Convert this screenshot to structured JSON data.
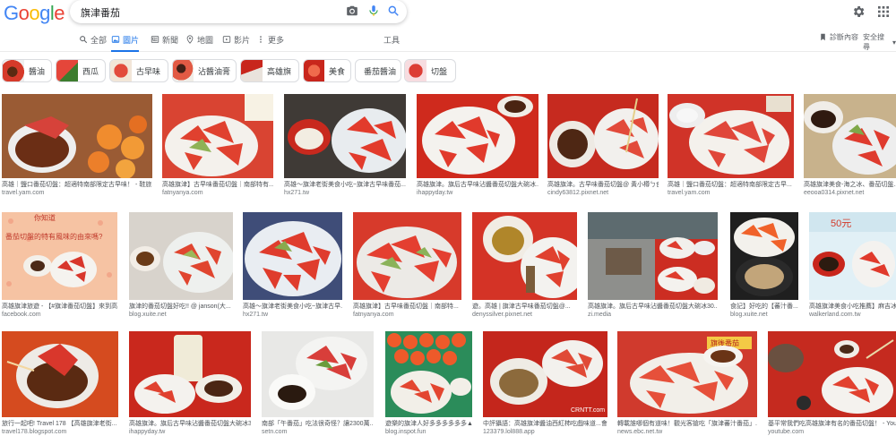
{
  "search": {
    "query": "旗津番茄"
  },
  "tabs": [
    {
      "label": "全部",
      "icon": "search-icon"
    },
    {
      "label": "圖片",
      "icon": "image-icon"
    },
    {
      "label": "新聞",
      "icon": "news-icon"
    },
    {
      "label": "地圖",
      "icon": "map-pin-icon"
    },
    {
      "label": "影片",
      "icon": "video-icon"
    },
    {
      "label": "更多",
      "icon": "more-vert-icon"
    }
  ],
  "tools_label": "工具",
  "collections_label": "診斷內容",
  "safesearch_label": "安全搜尋",
  "chips": [
    "醬油",
    "西瓜",
    "古早味",
    "沾醬油膏",
    "高雄旗",
    "美食",
    "番茄醬油",
    "切盤"
  ],
  "results": [
    {
      "title": "高雄｜鹽口番茄切盤：超適特南部限定古早味！ - 鞋旅...",
      "source": "travel.yam.com"
    },
    {
      "title": "高雄旗津】古早味番茄切盤｜南部特有...",
      "source": "fatnyanya.com"
    },
    {
      "title": "高雄～旗津老街美食小吃~旗津古早味番茄...",
      "source": "hx271.tw"
    },
    {
      "title": "高雄旗津。旗后古早味沾醬番茄切盤大碗冰...",
      "source": "ihappyday.tw"
    },
    {
      "title": "高雄旗津。古早味番茄切盤@ 黃小樽ㄅ食物...",
      "source": "cindy63812.pixnet.net"
    },
    {
      "title": "高雄｜鹽口番茄切盤：超適特南部限定古早...",
      "source": "travel.yam.com"
    },
    {
      "title": "高雄旗津美食-海之冰、番茄切盤...",
      "source": "eeooa0314.pixnet.net"
    },
    {
      "title": "高雄旗津旅遊 - 【#旗津番茄切盤】來到高...",
      "source": "facebook.com"
    },
    {
      "title": "旗津的番茄切盤好吃!! @ janson(大...",
      "source": "blog.xuite.net"
    },
    {
      "title": "高雄～旗津老街美食小吃~旗津古早...",
      "source": "hx271.tw"
    },
    {
      "title": "高雄旗津】古早味番茄切盤｜南部特...",
      "source": "fatnyanya.com"
    },
    {
      "title": "遊。高雄 | 旗津古早味番茄切盤@...",
      "source": "denyssilver.pixnet.net"
    },
    {
      "title": "高雄旗津。旗后古早味沾醬番茄切盤大碗冰30...",
      "source": "zi.media"
    },
    {
      "title": "食記】好吃的【蕃汁番...",
      "source": "blog.xuite.net"
    },
    {
      "title": "高雄旗津美食小吃推薦】麻吉冰鋪番...",
      "source": "walkerland.com.tw"
    },
    {
      "title": "旅行一起吧! Travel 178 【高雄旗津老街...",
      "source": "travel178.blogspot.com"
    },
    {
      "title": "高雄旗津。旗后古早味沾醬番茄切盤大碗冰30...",
      "source": "ihappyday.tw"
    },
    {
      "title": "南部「午番茄」吃法很奇怪？讓2300萬...",
      "source": "setn.com"
    },
    {
      "title": "遊樂的旗津人好多多多多多多▲...",
      "source": "blog.inspot.fun"
    },
    {
      "title": "中評攝語：高雄旗津醬油西紅柿吃戲味道...會...",
      "source": "123379.lol888.app"
    },
    {
      "title": "轉載誰哪個有道味！觀光客搶吃「旗津蕃汁番茄」...",
      "source": "news.ebc.net.tw"
    },
    {
      "title": "基平常我們吃高雄旗津有名的番茄切盤！ - YouTube",
      "source": "youtube.com"
    }
  ],
  "overlay_texts": {
    "r8_line1": "你知道",
    "r8_line2": "番茄切盤的特有風味的由來嗎?",
    "r15_price": "50元",
    "r20_sign": "CRNTT.com",
    "r21_sign": "旗後番茄"
  },
  "colors": {
    "blue": "#1a73e8",
    "tomato": "#d9342b",
    "plate": "#f5f5f3",
    "table_red": "#c8261c"
  }
}
